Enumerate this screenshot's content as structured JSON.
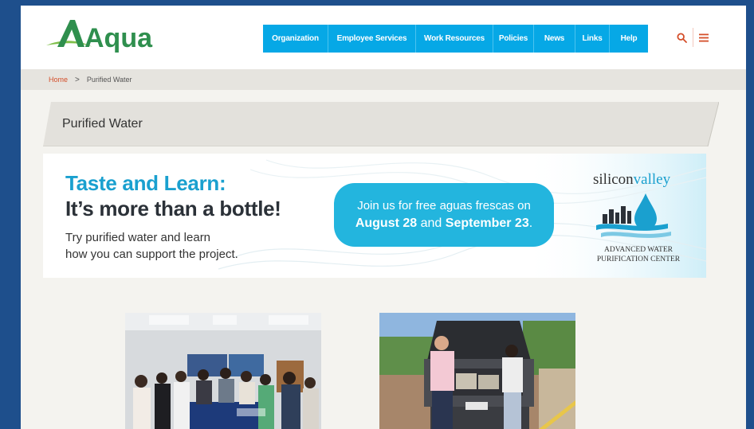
{
  "site": {
    "logo_text": "Aqua"
  },
  "nav": {
    "items": [
      {
        "label": "Organization"
      },
      {
        "label": "Employee Services"
      },
      {
        "label": "Work Resources"
      },
      {
        "label": "Policies"
      },
      {
        "label": "News"
      },
      {
        "label": "Links"
      },
      {
        "label": "Help"
      }
    ],
    "search_icon": "search-icon",
    "menu_icon": "hamburger-icon"
  },
  "breadcrumb": {
    "home": "Home",
    "separator": ">",
    "current": "Purified Water"
  },
  "page": {
    "title": "Purified Water"
  },
  "banner": {
    "headline": "Taste and Learn:",
    "subheadline": "It’s more than a bottle!",
    "body_line1": "Try purified water and learn",
    "body_line2": "how you can support the project.",
    "pill_line1": "Join us for free aguas frescas on",
    "pill_date1": "August 28",
    "pill_and": "and",
    "pill_date2": "September 23",
    "pill_end": ".",
    "logo_word1": "silicon",
    "logo_word2": "valley",
    "logo_line1": "ADVANCED WATER",
    "logo_line2": "PURIFICATION CENTER"
  },
  "colors": {
    "nav_blue": "#06a8e6",
    "accent_orange": "#d44e29",
    "frame_blue": "#1e4f8c",
    "banner_teal": "#1aa0cf",
    "logo_green": "#5aa848"
  }
}
